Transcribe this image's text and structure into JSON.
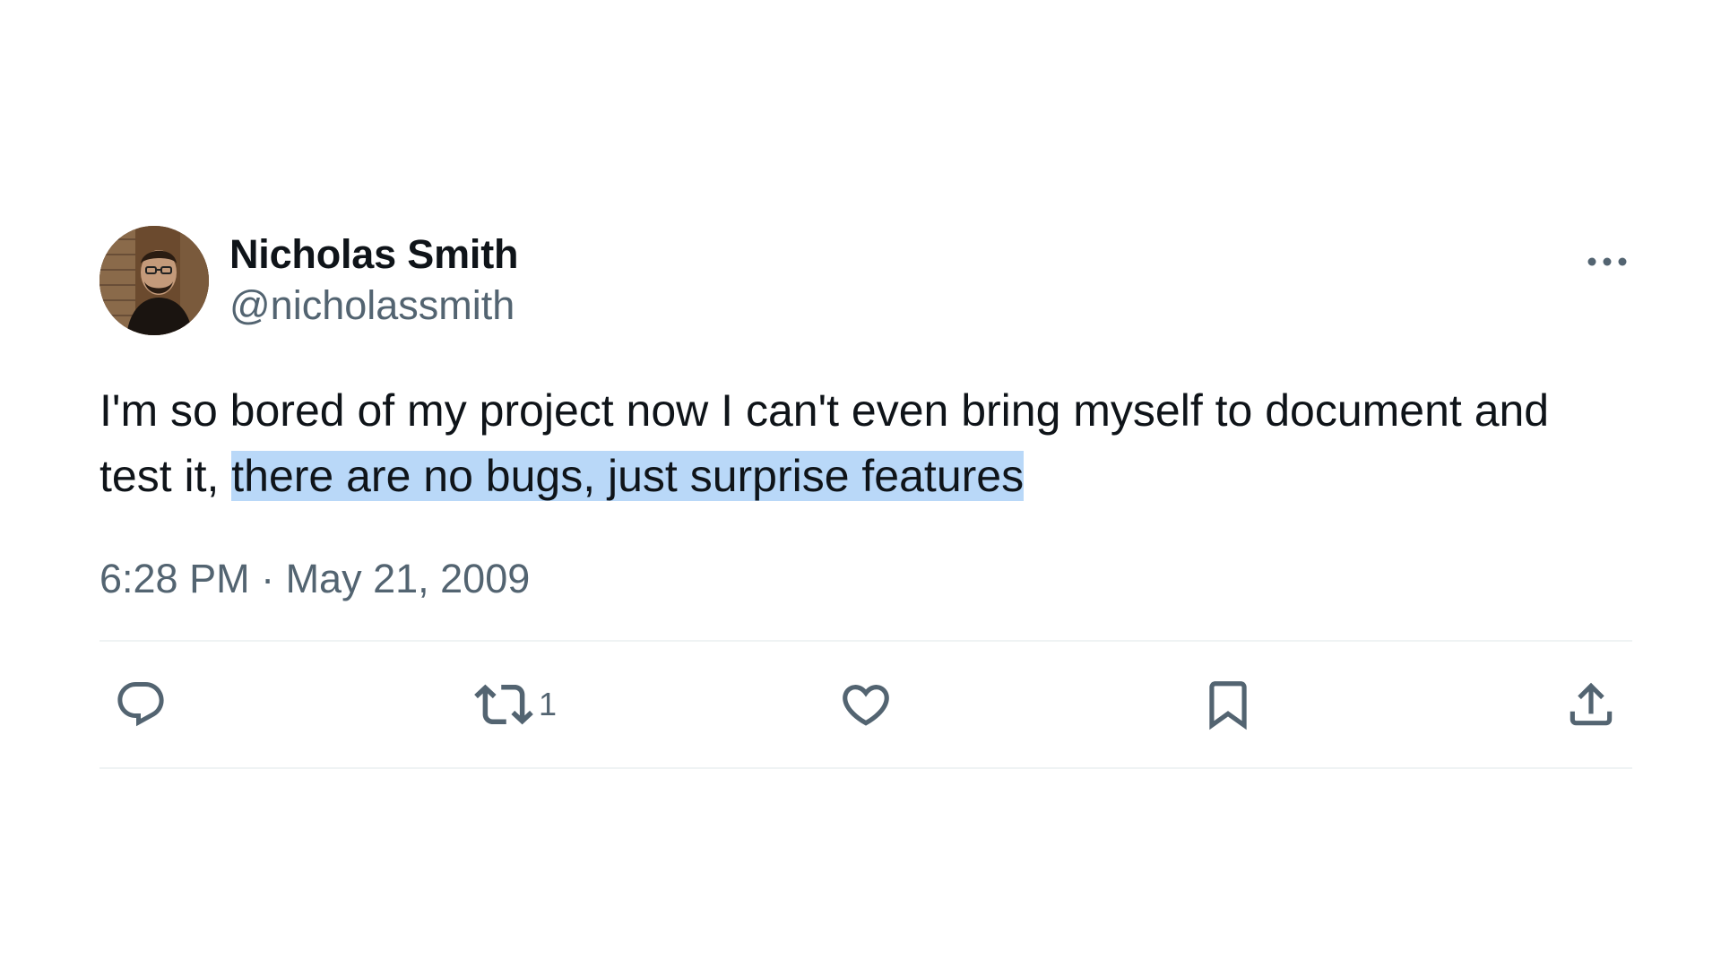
{
  "author": {
    "display_name": "Nicholas Smith",
    "handle": "@nicholassmith"
  },
  "tweet": {
    "text_plain": "I'm so bored of my project now I can't even bring myself to document and test it, ",
    "text_highlighted": "there are no bugs, just surprise features",
    "timestamp": "6:28 PM · May 21, 2009"
  },
  "actions": {
    "reply_icon": "reply-icon",
    "retweet_icon": "retweet-icon",
    "retweet_count": "1",
    "like_icon": "heart-icon",
    "bookmark_icon": "bookmark-icon",
    "share_icon": "share-icon"
  },
  "colors": {
    "text": "#0f1419",
    "secondary": "#536471",
    "highlight": "#b9d8f8",
    "divider": "#eff3f4"
  }
}
